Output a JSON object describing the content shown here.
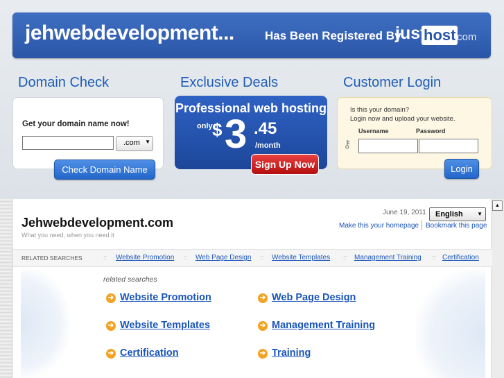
{
  "banner": {
    "domain": "jehwebdevelopment...",
    "registered_text": "Has Been Registered By",
    "brand_just": "just",
    "brand_host": "host",
    "brand_com": ".com"
  },
  "sections": {
    "domain_check": "Domain Check",
    "exclusive_deals": "Exclusive Deals",
    "customer_login": "Customer Login"
  },
  "domain_check": {
    "label": "Get your domain name now!",
    "input_value": "",
    "tld_selected": ".com",
    "button": "Check Domain Name"
  },
  "deals": {
    "title": "Professional web hosting",
    "only": "only",
    "dollar": "$",
    "price_big": "3",
    "price_cents": ".45",
    "per_month": "/month",
    "button": "Sign Up Now"
  },
  "login": {
    "question": "Is this your domain?",
    "subtext": "Login now and upload your website.",
    "username_label": "Username",
    "password_label": "Password",
    "button": "Login"
  },
  "site": {
    "title": "Jehwebdevelopment.com",
    "tagline": "What you need, when you need it",
    "date": "June 19, 2011",
    "language": "English",
    "make_homepage": "Make this your homepage",
    "bookmark": "Bookmark this page"
  },
  "related_bar": {
    "label": "RELATED SEARCHES",
    "separator": "::",
    "links": [
      "Website Promotion",
      "Web Page Design",
      "Website Templates",
      "Management Training",
      "Certification"
    ]
  },
  "related_searches": {
    "heading": "related searches",
    "items": [
      "Website Promotion",
      "Web Page Design",
      "Website Templates",
      "Management Training",
      "Certification",
      "Training"
    ]
  }
}
